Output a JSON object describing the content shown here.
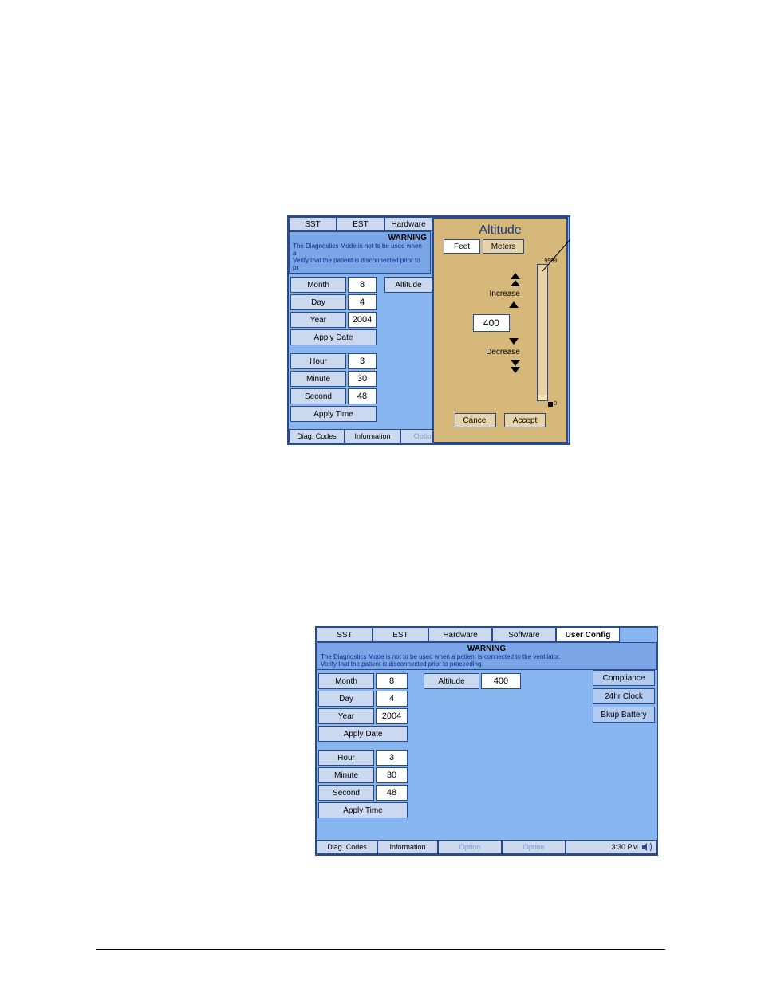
{
  "fig1": {
    "tabs": {
      "sst": "SST",
      "est": "EST",
      "hardware": "Hardware"
    },
    "warnTitle": "WARNING",
    "warnLine1": "The Diagnostics Mode is not to be used when a",
    "warnLine2": "Verify that the patient is disconnected prior to pr",
    "labels": {
      "month": "Month",
      "day": "Day",
      "year": "Year",
      "applyDate": "Apply Date",
      "hour": "Hour",
      "minute": "Minute",
      "second": "Second",
      "applyTime": "Apply Time",
      "altitude": "Altitude"
    },
    "values": {
      "month": "8",
      "day": "4",
      "year": "2004",
      "hour": "3",
      "minute": "30",
      "second": "48"
    },
    "bottom": {
      "diag": "Diag. Codes",
      "info": "Information",
      "option": "Option"
    }
  },
  "altPopup": {
    "title": "Altitude",
    "feet": "Feet",
    "meters": "Meters",
    "increase": "Increase",
    "decrease": "Decrease",
    "value": "400",
    "max": "9999",
    "min": "0",
    "cancel": "Cancel",
    "accept": "Accept"
  },
  "fig2": {
    "tabs": {
      "sst": "SST",
      "est": "EST",
      "hardware": "Hardware",
      "software": "Software",
      "userConfig": "User Config"
    },
    "warnTitle": "WARNING",
    "warnLine1": "The Diagnostics Mode is not to be used when a patient is connected to the ventilator.",
    "warnLine2": "Verify that the patient is disconnected prior to proceeding.",
    "labels": {
      "month": "Month",
      "day": "Day",
      "year": "Year",
      "applyDate": "Apply Date",
      "hour": "Hour",
      "minute": "Minute",
      "second": "Second",
      "applyTime": "Apply Time",
      "altitude": "Altitude"
    },
    "values": {
      "month": "8",
      "day": "4",
      "year": "2004",
      "hour": "3",
      "minute": "30",
      "second": "48",
      "altitude": "400"
    },
    "side": {
      "compliance": "Compliance",
      "clock": "24hr Clock",
      "battery": "Bkup Battery"
    },
    "bottom": {
      "diag": "Diag. Codes",
      "info": "Information",
      "option1": "Option",
      "option2": "Option",
      "time": "3:30 PM"
    }
  }
}
